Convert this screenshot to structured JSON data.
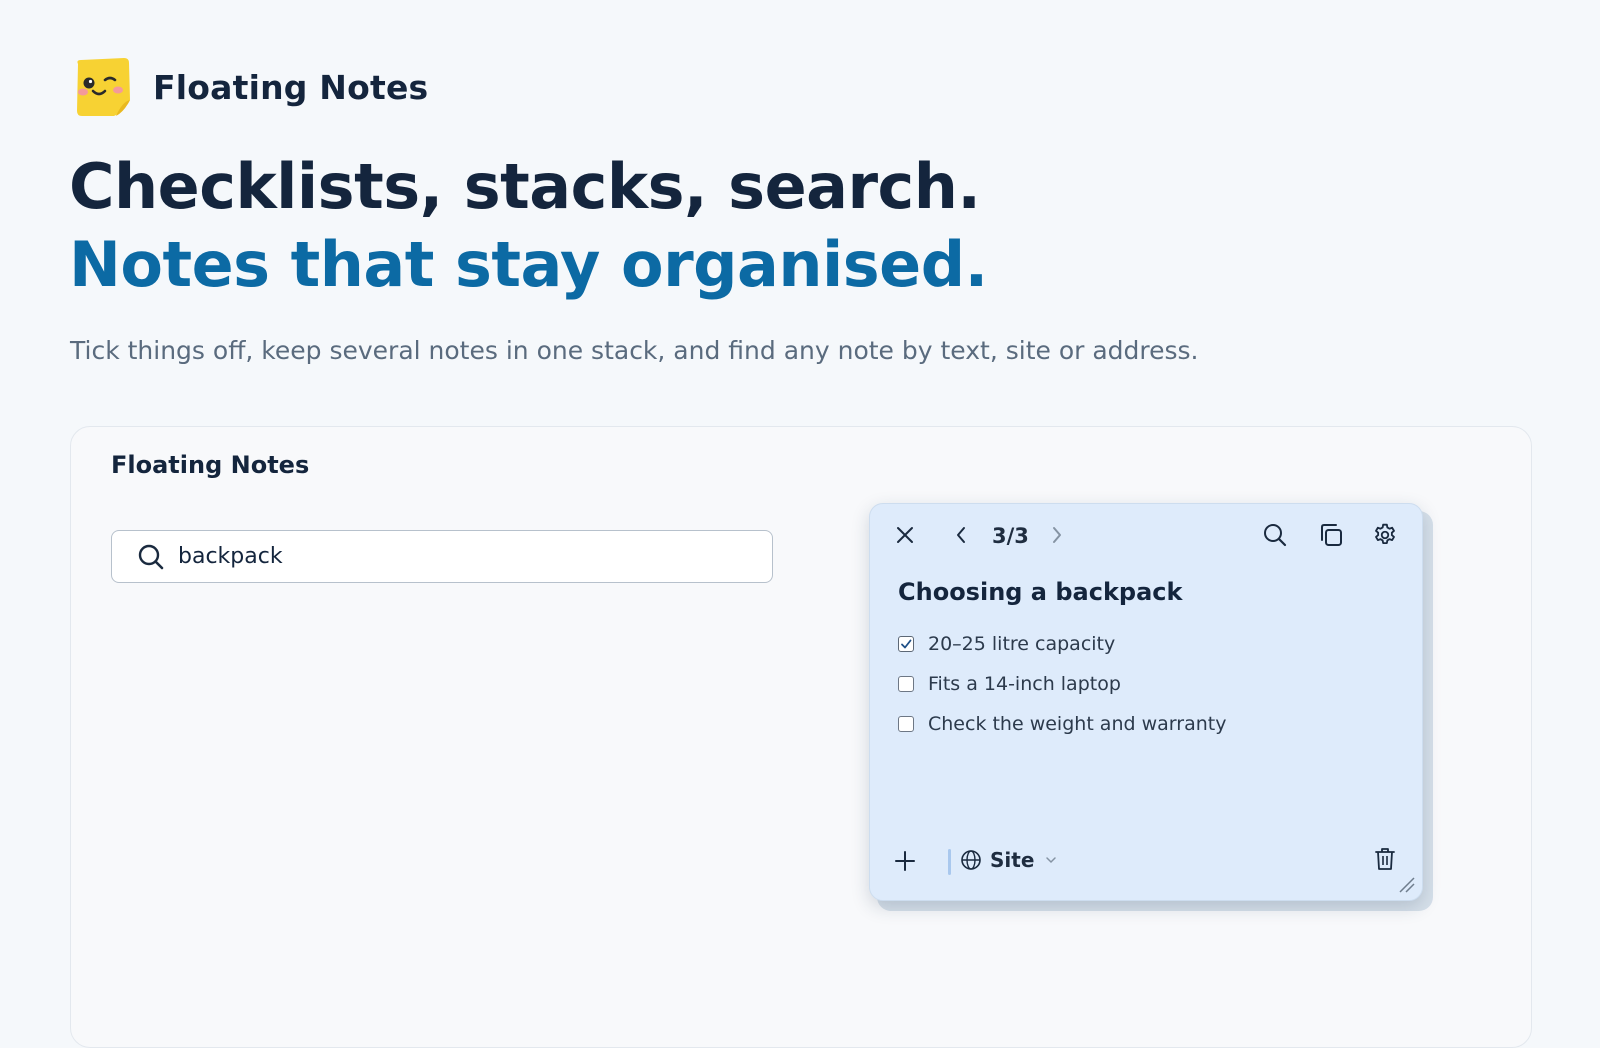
{
  "brand": {
    "name": "Floating Notes",
    "logo_icon": "sticky-note-wink-icon"
  },
  "hero": {
    "headline_line1": "Checklists, stacks, search.",
    "headline_line2": "Notes that stay organised.",
    "subtitle": "Tick things off, keep several notes in one stack, and find any note by text, site or address."
  },
  "demo": {
    "title": "Floating Notes",
    "search": {
      "value": "backpack",
      "icon": "search-icon"
    },
    "note": {
      "counter": "3/3",
      "title": "Choosing a backpack",
      "items": [
        {
          "text": "20–25 litre capacity",
          "checked": true
        },
        {
          "text": "Fits a 14-inch laptop",
          "checked": false
        },
        {
          "text": "Check the weight and warranty",
          "checked": false
        }
      ],
      "scope_label": "Site",
      "colors": {
        "background": "#deebfb",
        "accent": "#0c6aa4"
      }
    }
  }
}
